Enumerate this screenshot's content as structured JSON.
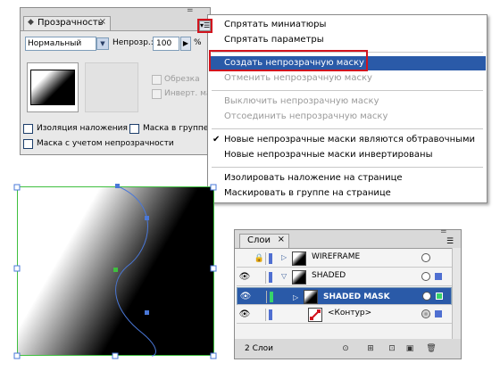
{
  "transparency_panel": {
    "tab_title": "Прозрачность",
    "tab_icon": "diamond-icon",
    "close_symbol": "×",
    "minimize_symbol": "=",
    "blend_mode": "Нормальный",
    "opacity_label": "Непрозр.:",
    "opacity_value": "100",
    "opacity_unit": "%",
    "clip_label": "Обрезка",
    "invert_mask_label": "Инверт. маска",
    "isolate_blending_label": "Изоляция наложения",
    "knockout_group_label": "Маска в группе",
    "opacity_mask_label": "Маска с учетом непрозрачности"
  },
  "flyout_menu": {
    "items": [
      {
        "label": "Спрятать миниатюры",
        "enabled": true
      },
      {
        "label": "Спрятать параметры",
        "enabled": true
      },
      {
        "label": "Создать непрозрачную маску",
        "enabled": true,
        "highlighted": true
      },
      {
        "label": "Отменить непрозрачную маску",
        "enabled": false
      },
      {
        "label": "Выключить непрозрачную маску",
        "enabled": false
      },
      {
        "label": "Отсоединить непрозрачную маску",
        "enabled": false
      },
      {
        "label": "Новые непрозрачные маски являются обтравочными",
        "enabled": true,
        "checked": true
      },
      {
        "label": "Новые непрозрачные маски инвертированы",
        "enabled": true
      },
      {
        "label": "Изолировать наложение на странице",
        "enabled": true
      },
      {
        "label": "Маскировать в группе на странице",
        "enabled": true
      }
    ],
    "check_symbol": "✔",
    "menu_button_symbol": "▾☰"
  },
  "layers_panel": {
    "tab_title": "Слои",
    "close_symbol": "×",
    "rows": [
      {
        "name": "WIREFRAME",
        "locked": true,
        "color": "#4f6fd1"
      },
      {
        "name": "SHADED",
        "locked": false,
        "color": "#4f6fd1"
      },
      {
        "name": "SHADED MASK",
        "locked": false,
        "color": "#36d46a"
      },
      {
        "name": "<Контур>",
        "locked": false,
        "color": "#4f6fd1"
      }
    ],
    "layer_count": "2 Слои",
    "colors": {
      "selection": "#2a5aa8",
      "highlight_border": "#d2141e"
    }
  }
}
